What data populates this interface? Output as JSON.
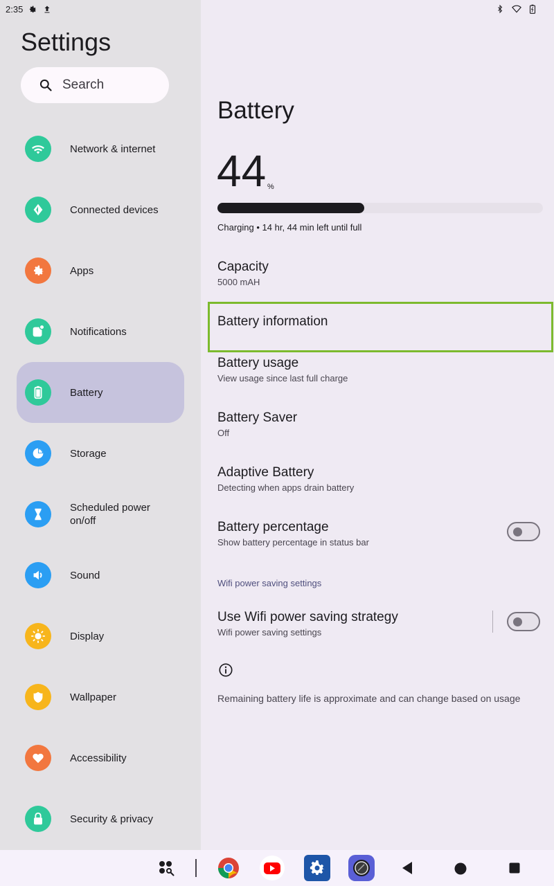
{
  "status_bar": {
    "time": "2:35"
  },
  "sidebar": {
    "title": "Settings",
    "search_label": "Search",
    "items": [
      {
        "label": "Network & internet",
        "icon": "wifi-icon",
        "color": "#2fc99a"
      },
      {
        "label": "Connected devices",
        "icon": "connected-devices-icon",
        "color": "#2fc99a"
      },
      {
        "label": "Apps",
        "icon": "apps-gear-icon",
        "color": "#f2773f"
      },
      {
        "label": "Notifications",
        "icon": "notifications-icon",
        "color": "#2fc99a"
      },
      {
        "label": "Battery",
        "icon": "battery-icon",
        "color": "#2fc99a",
        "selected": true
      },
      {
        "label": "Storage",
        "icon": "storage-pie-icon",
        "color": "#2b9ef3"
      },
      {
        "label": "Scheduled power on/off",
        "icon": "hourglass-icon",
        "color": "#2b9ef3"
      },
      {
        "label": "Sound",
        "icon": "speaker-icon",
        "color": "#2b9ef3"
      },
      {
        "label": "Display",
        "icon": "brightness-icon",
        "color": "#f7b51c"
      },
      {
        "label": "Wallpaper",
        "icon": "wallpaper-icon",
        "color": "#f7b51c"
      },
      {
        "label": "Accessibility",
        "icon": "heart-icon",
        "color": "#f2773f"
      },
      {
        "label": "Security & privacy",
        "icon": "lock-icon",
        "color": "#2fc99a"
      }
    ]
  },
  "battery": {
    "title": "Battery",
    "level": "44",
    "level_unit": "%",
    "level_fraction": 0.45,
    "charging_text": "Charging • 14 hr, 44 min left until full",
    "capacity_title": "Capacity",
    "capacity_value": "5000 mAH",
    "info_title": "Battery information",
    "usage_title": "Battery usage",
    "usage_sub": "View usage since last full charge",
    "saver_title": "Battery Saver",
    "saver_sub": "Off",
    "adaptive_title": "Adaptive Battery",
    "adaptive_sub": "Detecting when apps drain battery",
    "percentage_title": "Battery percentage",
    "percentage_sub": "Show battery percentage in status bar",
    "section_wifi": "Wifi power saving settings",
    "wifi_title": "Use Wifi power saving strategy",
    "wifi_sub": "Wifi power saving settings",
    "footer": "Remaining battery life is approximate and can change based on usage"
  },
  "colors": {
    "highlight": "#7cba2e",
    "selected_bg": "#c6c3dd"
  }
}
